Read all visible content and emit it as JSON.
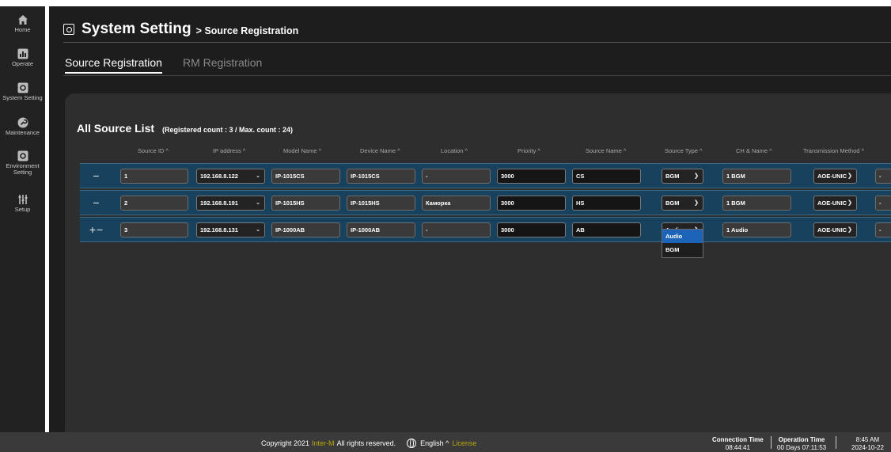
{
  "sidebar": {
    "items": [
      {
        "label": "Home",
        "icon": "home-icon"
      },
      {
        "label": "Operate",
        "icon": "chart-icon"
      },
      {
        "label": "System Setting",
        "icon": "settings-icon"
      },
      {
        "label": "Maintenance",
        "icon": "wrench-icon"
      },
      {
        "label": "Environment Setting",
        "icon": "environment-icon"
      },
      {
        "label": "Setup",
        "icon": "sliders-icon"
      }
    ]
  },
  "header": {
    "title": "System Setting",
    "subtitle": "> Source Registration"
  },
  "tabs": [
    {
      "label": "Source Registration",
      "active": true
    },
    {
      "label": "RM Registration",
      "active": false
    }
  ],
  "list": {
    "title": "All Source List",
    "count_text": "(Registered count : 3 / Max. count : 24)",
    "columns": [
      "Source ID ^",
      "IP address ^",
      "Model Name ^",
      "Device Name ^",
      "Location ^",
      "Priority ^",
      "Source Name ^",
      "Source Type ^",
      "CH & Name ^",
      "Transmission Method ^"
    ],
    "rows": [
      {
        "buttons": "−",
        "source_id": "1",
        "ip": "192.168.8.122",
        "model": "IP-1015CS",
        "device": "IP-1015CS",
        "location": "-",
        "priority": "3000",
        "source_name": "CS",
        "source_type": "BGM",
        "ch_name": "1 BGM",
        "transmission": "AOE-UNIC",
        "extra": "-"
      },
      {
        "buttons": "−",
        "source_id": "2",
        "ip": "192.168.8.191",
        "model": "IP-1015HS",
        "device": "IP-1015HS",
        "location": "Каморка",
        "priority": "3000",
        "source_name": "HS",
        "source_type": "BGM",
        "ch_name": "1 BGM",
        "transmission": "AOE-UNIC",
        "extra": "-"
      },
      {
        "buttons": "+−",
        "source_id": "3",
        "ip": "192.168.8.131",
        "model": "IP-1000AB",
        "device": "IP-1000AB",
        "location": "-",
        "priority": "3000",
        "source_name": "AB",
        "source_type": "Audio",
        "ch_name": "1 Audio",
        "transmission": "AOE-UNIC",
        "extra": "-"
      }
    ]
  },
  "dropdown": {
    "options": [
      "Audio",
      "BGM"
    ],
    "selected": "Audio"
  },
  "footer": {
    "copyright_prefix": "Copyright 2021",
    "company": "Inter-M",
    "copyright_suffix": "All rights reserved.",
    "language": "English ^",
    "license": "License",
    "connection_time_label": "Connection Time",
    "connection_time_value": "08:44:41",
    "operation_time_label": "Operation Time",
    "operation_time_value": "00 Days 07:11:53",
    "clock_time": "8:45 AM",
    "clock_date": "2024-10-22"
  },
  "colors": {
    "row_bg": "#17415d",
    "accent": "#b9a80e",
    "selected_option": "#1d64b8"
  }
}
